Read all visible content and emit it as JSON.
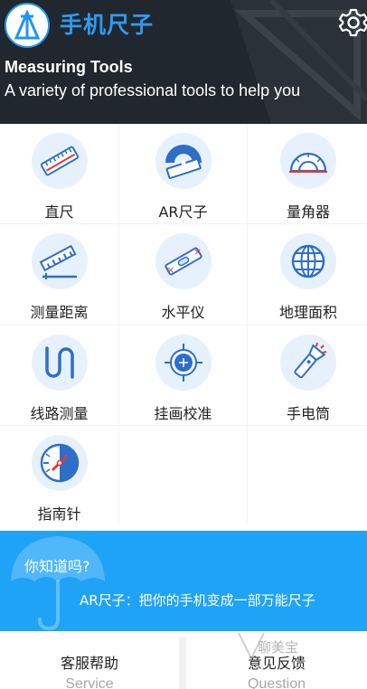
{
  "app": {
    "title": "手机尺子",
    "settings_icon": "gear-icon",
    "logo_icon": "ruler-logo-icon"
  },
  "header": {
    "heading": "Measuring Tools",
    "subtitle": "A variety of professional tools to help you"
  },
  "tools": [
    {
      "label": "直尺",
      "icon": "ruler-icon"
    },
    {
      "label": "AR尺子",
      "icon": "ar-ruler-icon"
    },
    {
      "label": "量角器",
      "icon": "protractor-icon"
    },
    {
      "label": "测量距离",
      "icon": "distance-measure-icon"
    },
    {
      "label": "水平仪",
      "icon": "level-icon"
    },
    {
      "label": "地理面积",
      "icon": "globe-icon"
    },
    {
      "label": "线路测量",
      "icon": "route-icon"
    },
    {
      "label": "挂画校准",
      "icon": "crosshair-icon"
    },
    {
      "label": "手电筒",
      "icon": "flashlight-icon"
    },
    {
      "label": "指南针",
      "icon": "compass-icon"
    }
  ],
  "banner": {
    "question": "你知道吗?",
    "tip": "AR尺子：把你的手机变成一部万能尺子"
  },
  "bottom": {
    "service_label": "客服帮助",
    "service_sub": "Service",
    "feedback_label": "意见反馈",
    "feedback_sub": "Question"
  },
  "watermark": "聊美宝",
  "colors": {
    "header_bg": "#20272e",
    "accent": "#2f9af0",
    "banner_bg": "#1fa3f7",
    "icon_bg": "#e7f1fd"
  }
}
